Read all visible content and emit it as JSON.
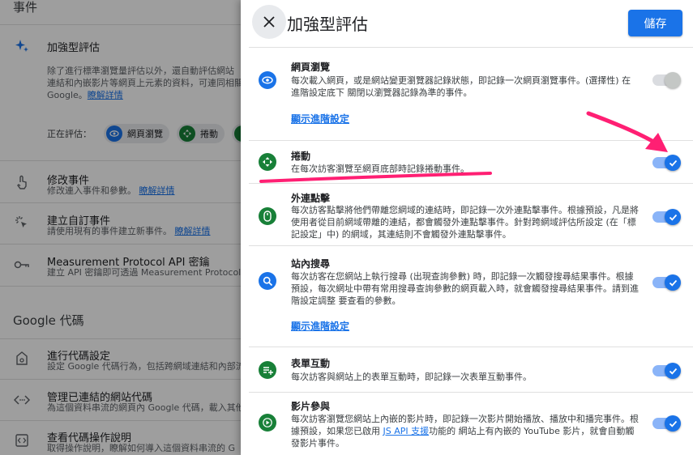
{
  "background": {
    "section_events": "事件",
    "enhanced": {
      "title": "加強型評估",
      "desc1": "除了進行標準瀏覽量評估以外，還自動評估網站",
      "desc2": "連結和內嵌影片等網頁上元素的資料，可連同相關",
      "desc3_prefix": "Google。",
      "learn_more": "瞭解詳情",
      "measuring_label": "正在評估：",
      "chips": [
        "網頁瀏覽",
        "捲動"
      ]
    },
    "items": [
      {
        "title": "修改事件",
        "desc": "修改連入事件和參數。",
        "link": "瞭解詳情"
      },
      {
        "title": "建立自訂事件",
        "desc": "請使用現有的事件建立新事件。",
        "link": "瞭解詳情"
      },
      {
        "title": "Measurement Protocol API 密鑰",
        "desc": "建立 API 密鑰即可透過 Measurement Protocol",
        "link": ""
      }
    ],
    "section_tag": "Google 代碼",
    "tag_items": [
      {
        "title": "進行代碼設定",
        "desc": "設定 Google 代碼行為，包括跨網域連結和內部流"
      },
      {
        "title": "管理已連結的網站代碼",
        "desc": "為這個資料串流的網頁內 Google 代碼，載入其他資"
      },
      {
        "title": "查看代碼操作說明",
        "desc": "取得操作說明，瞭解如何導入這個資料串流的 G"
      }
    ]
  },
  "drawer": {
    "title": "加強型評估",
    "save_label": "儲存",
    "advanced_link": "顯示進階設定",
    "events": [
      {
        "title": "網頁瀏覽",
        "desc": "每次載入網頁，或是網站變更瀏覽器記錄狀態，即記錄一次網頁瀏覽事件。(選擇性) 在進階設定底下 關閉以瀏覽器記錄為準的事件。",
        "enabled": true,
        "disabled_style": true
      },
      {
        "title": "捲動",
        "desc": "在每次訪客瀏覽至網頁底部時記錄捲動事件。",
        "enabled": true
      },
      {
        "title": "外連點擊",
        "desc": "每次訪客點擊將他們帶離您網域的連結時，即記錄一次外連點擊事件。根據預設，凡是將使用者從目前網域帶離的連結，都會觸發外連點擊事件。針對跨網域評估所設定 (在「標記設定」中) 的網域，其連結則不會觸發外連點擊事件。",
        "enabled": true
      },
      {
        "title": "站內搜尋",
        "desc": "每次訪客在您網站上執行搜尋 (出現查詢參數) 時，即記錄一次觸發搜尋結果事件。根據預設，每次網址中帶有常用搜尋查詢參數的網頁載入時，就會觸發搜尋結果事件。請到進階設定調整 要查看的參數。",
        "enabled": true
      },
      {
        "title": "表單互動",
        "desc": "每次訪客與網站上的表單互動時，即記錄一次表單互動事件。",
        "enabled": true
      },
      {
        "title": "影片參與",
        "desc_before": "每次訪客瀏覽您網站上內嵌的影片時，即記錄一次影片開始播放、播放中和播完事件。根據預設，如果您已啟用 ",
        "desc_link": "JS API 支援",
        "desc_after": "功能的 網站上有內嵌的 YouTube 影片，就會自動觸發影片事件。",
        "enabled": true
      }
    ]
  },
  "colors": {
    "accent": "#1a73e8",
    "annotation": "#ff1f73"
  }
}
